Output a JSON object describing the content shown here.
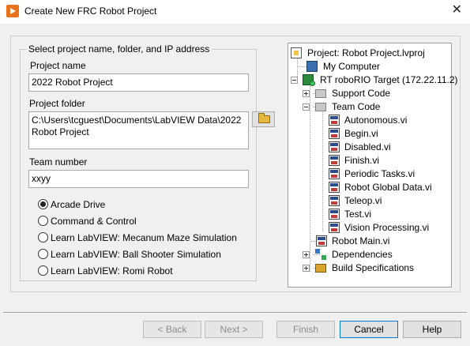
{
  "window": {
    "title": "Create New FRC Robot Project",
    "close_glyph": "✕"
  },
  "group": {
    "legend": "Select project name, folder, and IP address"
  },
  "project_name": {
    "label": "Project name",
    "value": "2022 Robot Project"
  },
  "project_folder": {
    "label": "Project folder",
    "value": "C:\\Users\\tcguest\\Documents\\LabVIEW Data\\2022 Robot Project"
  },
  "team_number": {
    "label": "Team number",
    "value": "xxyy"
  },
  "options": [
    {
      "label": "Arcade Drive",
      "selected": true
    },
    {
      "label": "Command & Control",
      "selected": false
    },
    {
      "label": "Learn LabVIEW: Mecanum Maze Simulation",
      "selected": false
    },
    {
      "label": "Learn LabVIEW: Ball Shooter Simulation",
      "selected": false
    },
    {
      "label": "Learn LabVIEW: Romi Robot",
      "selected": false
    }
  ],
  "tree": {
    "project": "Project: Robot Project.lvproj",
    "my_computer": "My Computer",
    "target": "RT roboRIO Target (172.22.11.2)",
    "support_code": "Support Code",
    "team_code": "Team Code",
    "team_code_items": [
      "Autonomous.vi",
      "Begin.vi",
      "Disabled.vi",
      "Finish.vi",
      "Periodic Tasks.vi",
      "Robot Global Data.vi",
      "Teleop.vi",
      "Test.vi",
      "Vision Processing.vi"
    ],
    "robot_main": "Robot Main.vi",
    "dependencies": "Dependencies",
    "build_specs": "Build Specifications"
  },
  "buttons": {
    "back": "< Back",
    "next": "Next >",
    "finish": "Finish",
    "cancel": "Cancel",
    "help": "Help"
  }
}
